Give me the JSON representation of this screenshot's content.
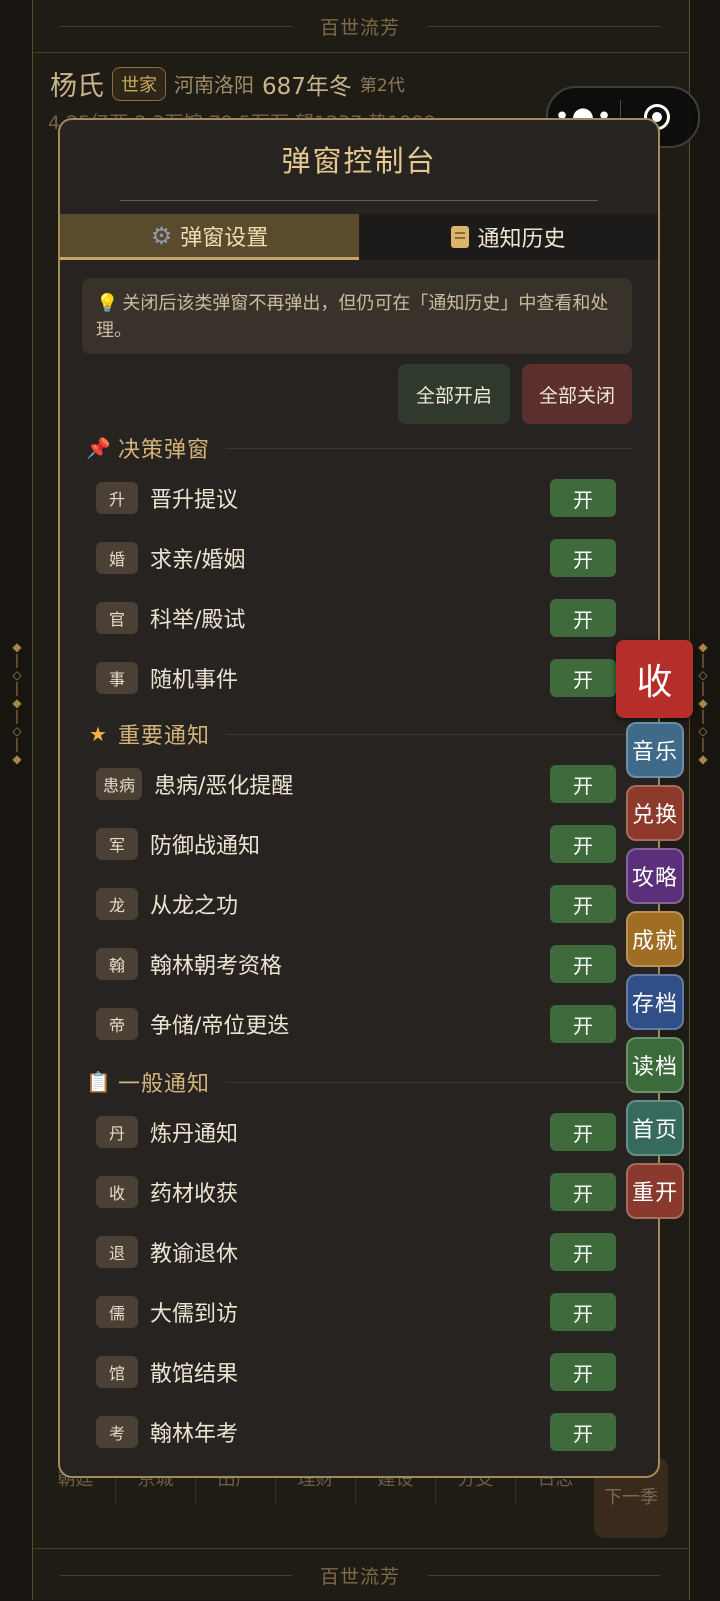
{
  "app": {
    "banner_top": "百世流芳",
    "banner_bottom": "百世流芳"
  },
  "family": {
    "name": "杨氏",
    "badge": "世家",
    "place": "河南洛阳",
    "year": "687年冬",
    "generation": "第2代",
    "stats": "4.25亿两 2.3万馆 79.5万石  望1237  势1999"
  },
  "bottom_tabs": [
    "朝廷",
    "京城",
    "田产",
    "理财",
    "建设",
    "分支",
    "日志"
  ],
  "next_season": "下一季",
  "capsule": {
    "more_icon": "more-dots-icon",
    "close_icon": "target-circle-icon"
  },
  "modal": {
    "title": "弹窗控制台",
    "tabs": [
      {
        "label": "弹窗设置",
        "icon": "gear-icon",
        "active": true
      },
      {
        "label": "通知历史",
        "icon": "scroll-icon",
        "active": false
      }
    ],
    "notice": {
      "icon": "lightbulb-icon",
      "text": "关闭后该类弹窗不再弹出，但仍可在「通知历史」中查看和处理。"
    },
    "enable_all": "全部开启",
    "disable_all": "全部关闭",
    "sections": [
      {
        "title": "决策弹窗",
        "icon": "pushpin-icon",
        "items": [
          {
            "tag": "升",
            "label": "晋升提议",
            "state": "开"
          },
          {
            "tag": "婚",
            "label": "求亲/婚姻",
            "state": "开"
          },
          {
            "tag": "官",
            "label": "科举/殿试",
            "state": "开"
          },
          {
            "tag": "事",
            "label": "随机事件",
            "state": "开"
          }
        ]
      },
      {
        "title": "重要通知",
        "icon": "star-icon",
        "items": [
          {
            "tag": "患病",
            "label": "患病/恶化提醒",
            "state": "开"
          },
          {
            "tag": "军",
            "label": "防御战通知",
            "state": "开"
          },
          {
            "tag": "龙",
            "label": "从龙之功",
            "state": "开"
          },
          {
            "tag": "翰",
            "label": "翰林朝考资格",
            "state": "开"
          },
          {
            "tag": "帝",
            "label": "争储/帝位更迭",
            "state": "开"
          }
        ]
      },
      {
        "title": "一般通知",
        "icon": "clipboard-icon",
        "items": [
          {
            "tag": "丹",
            "label": "炼丹通知",
            "state": "开"
          },
          {
            "tag": "收",
            "label": "药材收获",
            "state": "开"
          },
          {
            "tag": "退",
            "label": "教谕退休",
            "state": "开"
          },
          {
            "tag": "儒",
            "label": "大儒到访",
            "state": "开"
          },
          {
            "tag": "馆",
            "label": "散馆结果",
            "state": "开"
          },
          {
            "tag": "考",
            "label": "翰林年考",
            "state": "开"
          }
        ]
      }
    ]
  },
  "side_menu": {
    "collapse": "收",
    "items": [
      {
        "label": "音乐",
        "color": "#3f6a8a"
      },
      {
        "label": "兑换",
        "color": "#8d3a2c"
      },
      {
        "label": "攻略",
        "color": "#5b2f7a"
      },
      {
        "label": "成就",
        "color": "#a06d24"
      },
      {
        "label": "存档",
        "color": "#2f4f86"
      },
      {
        "label": "读档",
        "color": "#3c6b3b"
      },
      {
        "label": "首页",
        "color": "#356a5c"
      },
      {
        "label": "重开",
        "color": "#8a3a2c"
      }
    ]
  }
}
